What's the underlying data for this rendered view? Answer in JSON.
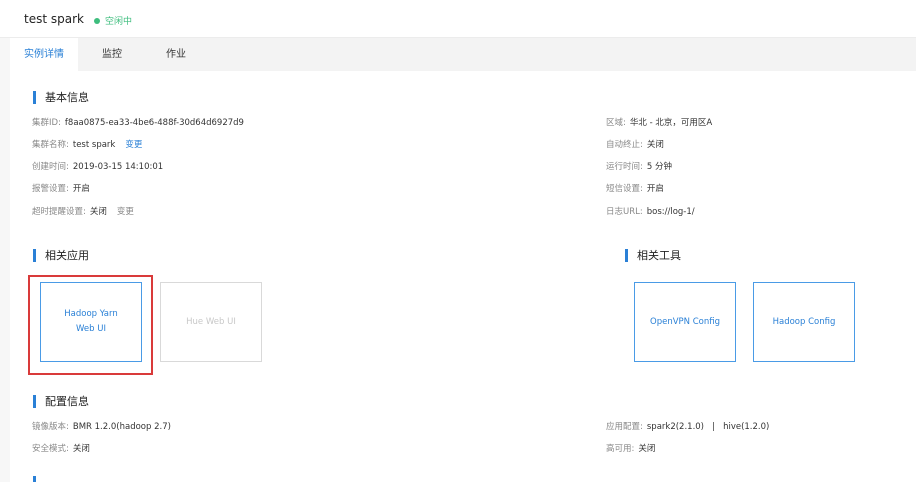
{
  "header": {
    "title": "test spark",
    "status": "空闲中"
  },
  "tabs": [
    {
      "label": "实例详情",
      "active": true
    },
    {
      "label": "监控",
      "active": false
    },
    {
      "label": "作业",
      "active": false
    }
  ],
  "basic": {
    "section_title": "基本信息",
    "cluster_id": {
      "label": "集群ID:",
      "value": "f8aa0875-ea33-4be6-488f-30d64d6927d9"
    },
    "cluster_name": {
      "label": "集群名称:",
      "value": "test spark",
      "action": "变更"
    },
    "created": {
      "label": "创建时间:",
      "value": "2019-03-15 14:10:01"
    },
    "alarm": {
      "label": "报警设置:",
      "value": "开启"
    },
    "timeout": {
      "label": "超时提醒设置:",
      "value": "关闭",
      "action": "变更"
    },
    "region": {
      "label": "区域:",
      "value": "华北 - 北京，可用区A"
    },
    "auto_stop": {
      "label": "自动终止:",
      "value": "关闭"
    },
    "runtime": {
      "label": "运行时间:",
      "value": "5 分钟"
    },
    "sms": {
      "label": "短信设置:",
      "value": "开启"
    },
    "log_url": {
      "label": "日志URL:",
      "value": "bos://log-1/"
    }
  },
  "apps": {
    "section_title": "相关应用",
    "items": [
      {
        "line1": "Hadoop Yarn",
        "line2": "Web UI"
      },
      {
        "line1": "Hue Web UI"
      }
    ]
  },
  "tools": {
    "section_title": "相关工具",
    "items": [
      "OpenVPN Config",
      "Hadoop Config"
    ]
  },
  "config": {
    "section_title": "配置信息",
    "image": {
      "label": "镜像版本:",
      "value": "BMR 1.2.0(hadoop 2.7)"
    },
    "security": {
      "label": "安全模式:",
      "value": "关闭"
    },
    "app_config": {
      "label": "应用配置:",
      "value": "spark2(2.1.0)   |   hive(1.2.0)"
    },
    "ha": {
      "label": "高可用:",
      "value": "关闭"
    }
  },
  "colors": {
    "accent": "#2a80d6",
    "status": "#3dbd7d",
    "highlight": "#d93a3a"
  }
}
